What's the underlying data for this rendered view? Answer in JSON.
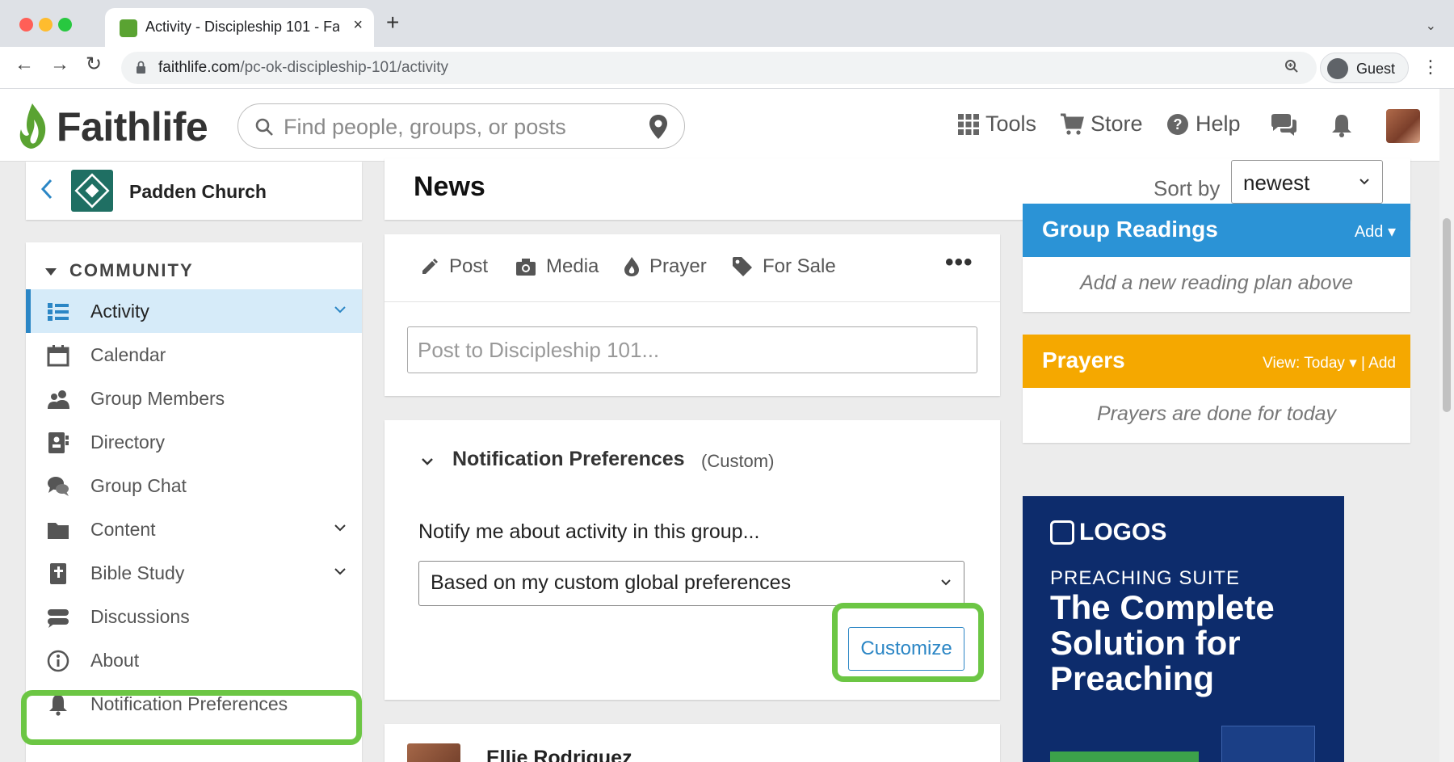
{
  "browser": {
    "tab_title": "Activity - Discipleship 101 - Faithlife",
    "tab_close": "×",
    "new_tab": "+",
    "tab_menu": "⌄",
    "url_host": "faithlife.com",
    "url_path": "/pc-ok-discipleship-101/activity",
    "profile_label": "Guest",
    "back": "←",
    "forward": "→",
    "reload": "↻",
    "menu": "⋮"
  },
  "header": {
    "logo_text": "Faithlife",
    "search_placeholder": "Find people, groups, or posts",
    "nav": {
      "tools": "Tools",
      "store": "Store",
      "help": "Help"
    }
  },
  "sidebar": {
    "group_name": "Padden Church",
    "section_label": "COMMUNITY",
    "items": [
      {
        "label": "Activity",
        "icon": "activity-list-icon",
        "expandable": true,
        "active": true
      },
      {
        "label": "Calendar",
        "icon": "calendar-icon",
        "expandable": false
      },
      {
        "label": "Group Members",
        "icon": "people-icon",
        "expandable": false
      },
      {
        "label": "Directory",
        "icon": "directory-icon",
        "expandable": false
      },
      {
        "label": "Group Chat",
        "icon": "chat-bubbles-icon",
        "expandable": false
      },
      {
        "label": "Content",
        "icon": "folder-icon",
        "expandable": true
      },
      {
        "label": "Bible Study",
        "icon": "bible-icon",
        "expandable": true
      },
      {
        "label": "Discussions",
        "icon": "discussions-icon",
        "expandable": false
      },
      {
        "label": "About",
        "icon": "info-icon",
        "expandable": false
      },
      {
        "label": "Notification Preferences",
        "icon": "bell-icon",
        "expandable": false
      }
    ]
  },
  "news": {
    "title": "News",
    "sort_label": "Sort by",
    "sort_value": "newest"
  },
  "composer": {
    "tabs": [
      "Post",
      "Media",
      "Prayer",
      "For Sale"
    ],
    "more": "•••",
    "input_placeholder": "Post to Discipleship 101..."
  },
  "notification_prefs": {
    "title": "Notification Preferences",
    "mode": "(Custom)",
    "prompt": "Notify me about activity in this group...",
    "select_value": "Based on my custom global preferences",
    "customize_label": "Customize"
  },
  "post": {
    "author": "Ellie Rodriguez"
  },
  "readings": {
    "title": "Group Readings",
    "add": "Add ▾",
    "empty": "Add a new reading plan above"
  },
  "prayers": {
    "title": "Prayers",
    "view": "View: Today ▾ | Add",
    "empty": "Prayers are done for today"
  },
  "ad": {
    "brand": "LOGOS",
    "suite": "PREACHING SUITE",
    "headline": "The Complete Solution for Preaching"
  },
  "colors": {
    "accent_blue": "#2b86c5",
    "highlight_green": "#6cc644",
    "readings_blue": "#2b93d6",
    "prayers_orange": "#f5a800",
    "ad_navy": "#0d2c6c"
  }
}
